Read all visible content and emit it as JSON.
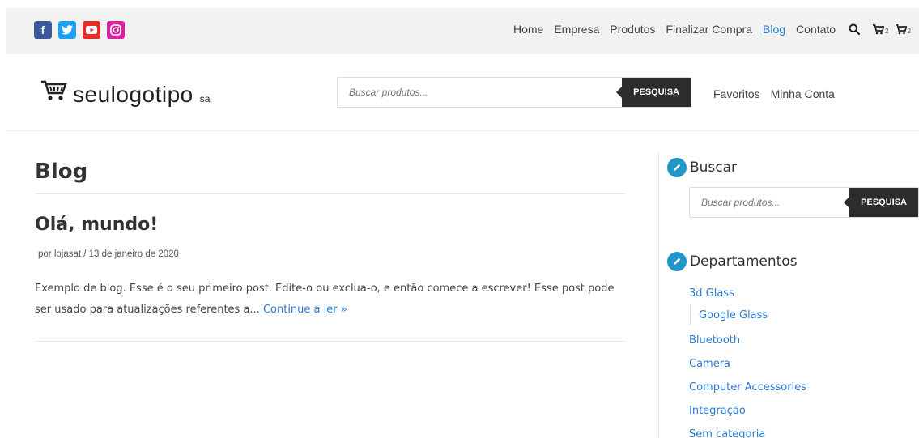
{
  "social": [
    {
      "name": "facebook-icon",
      "glyph": "f",
      "color": "#3b5998"
    },
    {
      "name": "twitter-icon",
      "glyph": "t",
      "color": "#1da1f2"
    },
    {
      "name": "youtube-icon",
      "glyph": "▶",
      "color": "#e52d27"
    },
    {
      "name": "instagram-icon",
      "glyph": "◎",
      "color": "#d6249f"
    }
  ],
  "topnav": {
    "items": [
      "Home",
      "Empresa",
      "Produtos",
      "Finalizar Compra",
      "Blog",
      "Contato"
    ],
    "active": "Blog",
    "cart_count_1": "2",
    "cart_count_2": "2"
  },
  "header": {
    "logo_text": "seulogotipo",
    "logo_suffix": "sa",
    "search_placeholder": "Buscar produtos...",
    "search_button": "PESQUISA",
    "links": [
      "Favoritos",
      "Minha Conta"
    ]
  },
  "main": {
    "page_title": "Blog",
    "post": {
      "title": "Olá, mundo!",
      "meta": "por lojasat / 13 de janeiro de 2020",
      "excerpt": "Exemplo de blog. Esse é o seu primeiro post. Edite-o ou exclua-o, e então comece a escrever! Esse post pode ser usado para atualizações referentes a...",
      "read_more": "Continue a ler »"
    }
  },
  "sidebar": {
    "search_title": "Buscar",
    "search_placeholder": "Buscar produtos...",
    "search_button": "PESQUISA",
    "departments_title": "Departamentos",
    "categories": [
      "3d Glass",
      "Google Glass",
      "Bluetooth",
      "Camera",
      "Computer Accessories",
      "Integração",
      "Sem categoria"
    ]
  },
  "colors": {
    "accent": "#2b7bd4",
    "widget_icon": "#2196c8",
    "button": "#2d2d2d"
  }
}
